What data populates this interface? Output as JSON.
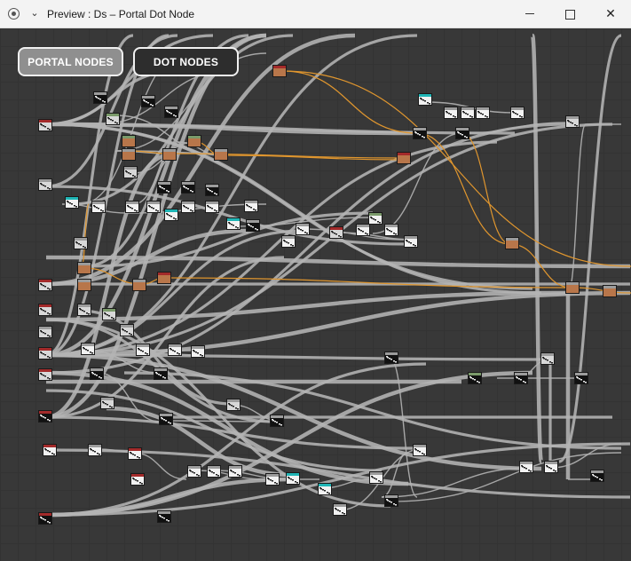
{
  "window": {
    "title": "Preview : Ds – Portal Dot Node",
    "minimize_glyph": "—",
    "maximize_glyph": "□",
    "close_glyph": "✕",
    "app_icon": "record-icon",
    "menu_icon": "chevron-down-icon"
  },
  "toolbar": {
    "portal_nodes_label": "PORTAL NODES",
    "dot_nodes_label": "DOT NODES"
  },
  "graph": {
    "colors": {
      "background": "#383838",
      "wire": "#b4b4b4",
      "wire_highlight": "#e0962e",
      "node_header_red": "#a32a2a",
      "node_header_teal": "#1fb5b5",
      "node_header_gray": "#9c9c9c",
      "node_header_green": "#7a9a6a",
      "node_brown": "#b8764a",
      "node_black": "#111111",
      "node_white": "#f2f2f2"
    }
  }
}
